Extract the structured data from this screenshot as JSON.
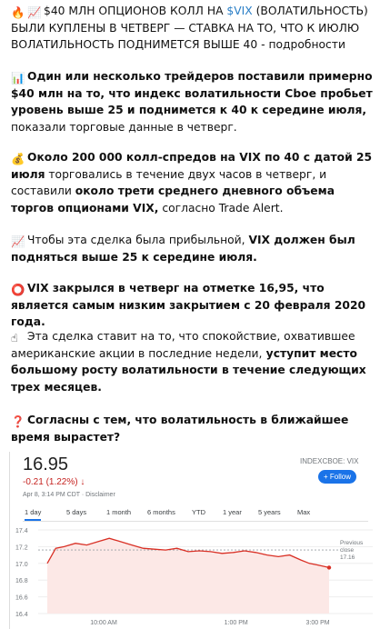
{
  "post": {
    "p1": {
      "a": "$40 МЛН ОПЦИОНОВ КОЛЛ НА ",
      "link": "$VIX",
      "b": " (ВОЛАТИЛЬНОСТЬ) БЫЛИ КУПЛЕНЫ В ЧЕТВЕРГ — СТАВКА НА ТО, ЧТО К ИЮЛЮ ВОЛАТИЛЬНОСТЬ ПОДНИМЕТСЯ ВЫШЕ 40",
      "c": " - подробности"
    },
    "p2": {
      "a": "Один или несколько трейдеров поставили примерно $40 млн на то, что индекс волатильности Cboe пробьет уровень выше 25 и поднимется к 40 к середине июля,",
      "b": " показали торговые данные в четверг."
    },
    "p3": {
      "a": "Около 200 000 колл-спредов на VIX по 40 с датой 25 июля",
      "b": " торговались в течение двух часов в четверг, и составили ",
      "c": "около трети среднего дневного объема торгов опционами VIX,",
      "d": " согласно Trade Alert."
    },
    "p4": {
      "a": "Чтобы эта сделка была прибыльной, ",
      "b": "VIX должен был подняться выше 25 к середине июля."
    },
    "p5": {
      "a": "VIX закрылся в четверг на отметке 16,95, что является самым низким закрытием с 20 февраля 2020 года."
    },
    "p6": {
      "a": "Эта сделка ставит на то, что спокойствие, охватившее американские акции в последние недели,",
      "b": " уступит место большому росту волатильности в течение следующих трех месяцев."
    },
    "p7": {
      "a": "Согласны с тем, что волатильность в ближайшее время вырастет?"
    }
  },
  "emoji": {
    "fire": "🔥",
    "chart_up": "📈",
    "bar_chart": "📊",
    "money_bag": "💰",
    "circle": "⭕",
    "point_up": "☝",
    "question": "❓"
  },
  "quote": {
    "price": "16.95",
    "change": "-0.21 (1.22%) ↓",
    "timestamp": "Apr 8, 3:14 PM CDT · Disclaimer",
    "ticker": "INDEXCBOE: VIX",
    "follow": "+ Follow",
    "tabs": [
      "1 day",
      "5 days",
      "1 month",
      "6 months",
      "YTD",
      "1 year",
      "5 years",
      "Max"
    ],
    "previous_close_label": [
      "Previous",
      "close"
    ],
    "previous_close_value": "17.16"
  },
  "colors": {
    "line": "#d93025",
    "fill": "#fce8e6",
    "link": "#2a7ec6",
    "accent": "#1a73e8"
  },
  "chart_data": {
    "type": "area",
    "x_ticks": [
      "10:00 AM",
      "1:00 PM",
      "3:00 PM"
    ],
    "y_ticks": [
      17.4,
      17.2,
      17.0,
      16.8,
      16.6,
      16.4
    ],
    "ylim": [
      16.4,
      17.4
    ],
    "previous_close": 17.16,
    "x": [
      0.0,
      0.03,
      0.06,
      0.1,
      0.14,
      0.18,
      0.22,
      0.26,
      0.3,
      0.34,
      0.38,
      0.42,
      0.46,
      0.5,
      0.54,
      0.58,
      0.62,
      0.66,
      0.7,
      0.74,
      0.78,
      0.82,
      0.86,
      0.9,
      0.93,
      0.96,
      1.0
    ],
    "values": [
      17.0,
      17.18,
      17.2,
      17.24,
      17.22,
      17.26,
      17.3,
      17.26,
      17.22,
      17.18,
      17.17,
      17.16,
      17.18,
      17.14,
      17.15,
      17.14,
      17.12,
      17.13,
      17.15,
      17.13,
      17.1,
      17.08,
      17.1,
      17.04,
      17.0,
      16.98,
      16.95
    ]
  }
}
